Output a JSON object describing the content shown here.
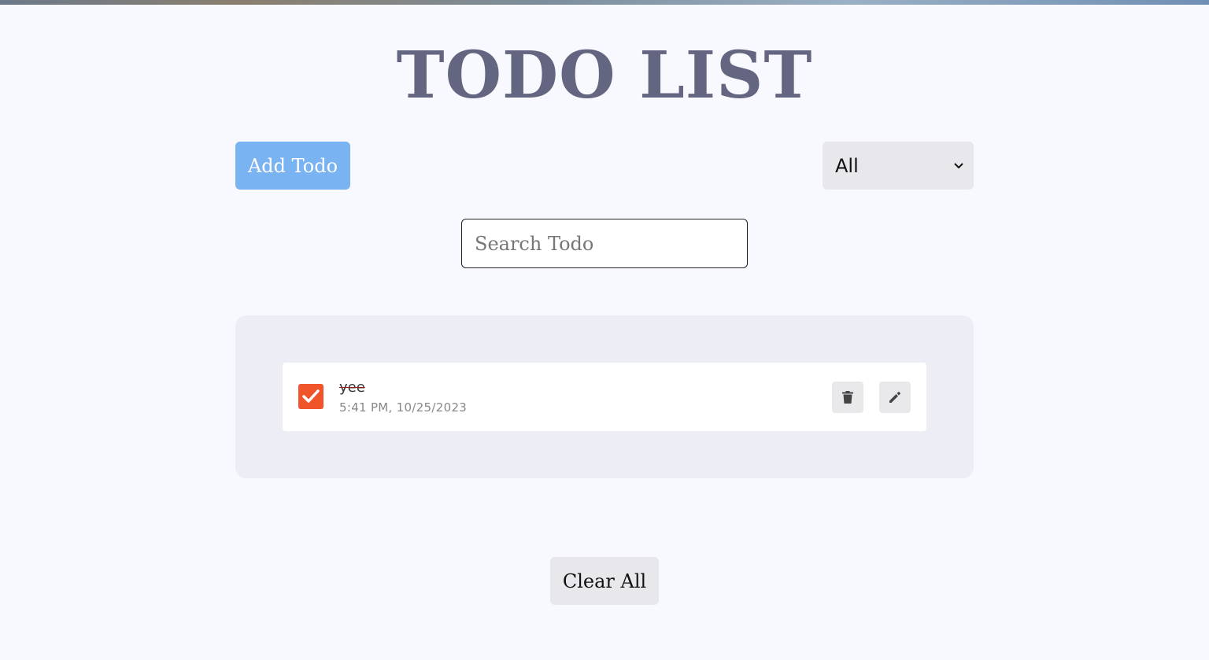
{
  "header": {
    "title": "TODO LIST"
  },
  "controls": {
    "add_button_label": "Add Todo",
    "filter_selected": "All",
    "search_placeholder": "Search Todo",
    "search_value": ""
  },
  "todos": [
    {
      "title": "yee",
      "time": "5:41 PM, 10/25/2023",
      "completed": true
    }
  ],
  "footer": {
    "clear_button_label": "Clear All"
  },
  "colors": {
    "title": "#646681",
    "primary_button": "#7ab3f1",
    "checkbox_checked": "#f0552a",
    "panel_background": "#ecedf5",
    "page_background": "#f8f9fe"
  },
  "icons": {
    "delete": "trash-icon",
    "edit": "pencil-icon",
    "dropdown": "chevron-down-icon",
    "check": "checkmark-icon"
  }
}
